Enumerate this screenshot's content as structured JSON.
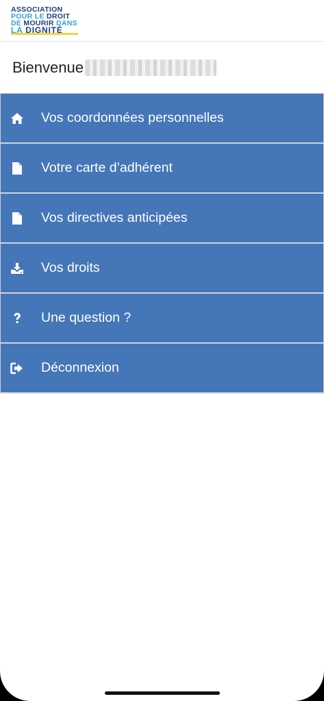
{
  "logo": {
    "line1": "ASSOCIATION",
    "line2a": "POUR LE",
    "line2b": "DROIT",
    "line3a": "DE",
    "line3b": "MOURIR",
    "line3c": "DANS",
    "line4a": "LA",
    "line4b": "DIGNITÉ"
  },
  "welcome": {
    "label": "Bienvenue"
  },
  "menu": {
    "items": [
      {
        "label": "Vos coordonnées personnelles",
        "icon": "home-icon"
      },
      {
        "label": "Votre carte d’adhérent",
        "icon": "file-icon"
      },
      {
        "label": "Vos directives anticipées",
        "icon": "file-icon"
      },
      {
        "label": "Vos droits",
        "icon": "download-icon"
      },
      {
        "label": "Une question ?",
        "icon": "question-icon"
      },
      {
        "label": "Déconnexion",
        "icon": "logout-icon"
      }
    ]
  },
  "colors": {
    "menu_bg": "#4476b8",
    "logo_dark": "#1f3d7a",
    "logo_light": "#2fa3d9",
    "logo_accent": "#f4d33c"
  }
}
